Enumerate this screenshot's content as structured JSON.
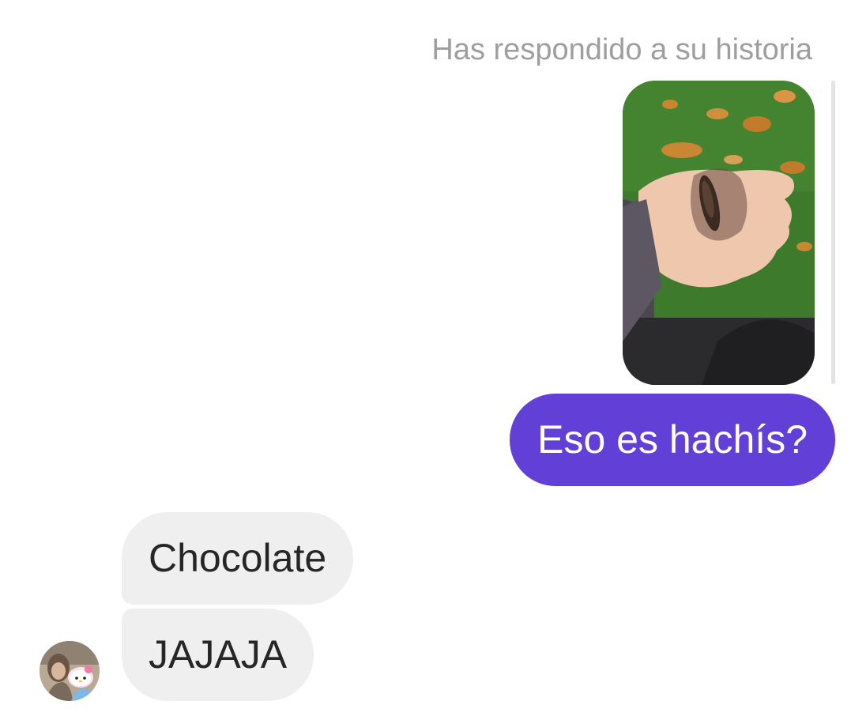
{
  "thread": {
    "reply_note": "Has respondido a su historia",
    "story_reply": {
      "thumbnail_icon": "story-photo-hand-holding-wrapped-piece",
      "message": "Eso es hachís?"
    },
    "incoming": [
      {
        "text": "Chocolate"
      },
      {
        "text": "JAJAJA"
      }
    ],
    "contact_avatar_icon": "user-avatar-photo"
  },
  "colors": {
    "outgoing_bubble": "#6240d8",
    "incoming_bubble": "#efefef",
    "meta_text": "#9e9e9e",
    "background": "#ffffff"
  }
}
